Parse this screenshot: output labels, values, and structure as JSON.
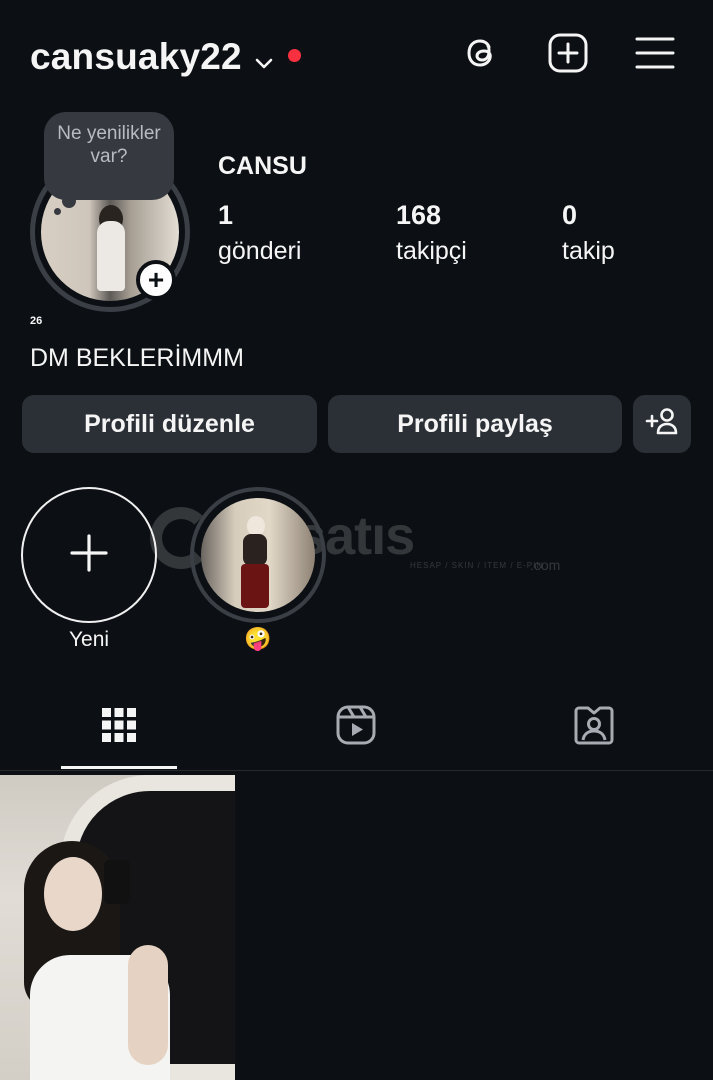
{
  "header": {
    "username": "cansuaky22",
    "icons": [
      "chevron-down-icon",
      "threads-icon",
      "create-post-icon",
      "menu-icon"
    ],
    "notification_color": "#ff3040"
  },
  "profile": {
    "note_text": "Ne yenilikler var?",
    "age_badge": "26",
    "display_name": "CANSU",
    "stats": [
      {
        "value": "1",
        "label": "gönderi"
      },
      {
        "value": "168",
        "label": "takipçi"
      },
      {
        "value": "0",
        "label": "takip"
      }
    ],
    "bio": "DM BEKLERİMMM"
  },
  "actions": {
    "edit_profile": "Profili düzenle",
    "share_profile": "Profili paylaş",
    "discover_people_icon": "add-person-icon"
  },
  "highlights": {
    "new_label": "Yeni",
    "items": [
      {
        "label": "🤪"
      }
    ]
  },
  "watermark": {
    "text": "emsatıs",
    "sub": "HESAP / SKIN / ITEM / E-PIN",
    "suffix": ".com"
  },
  "tabs": [
    "grid-icon",
    "reels-icon",
    "tagged-icon"
  ],
  "colors": {
    "background": "#0c1014",
    "button": "#2b3036",
    "text": "#f5f5f5"
  }
}
